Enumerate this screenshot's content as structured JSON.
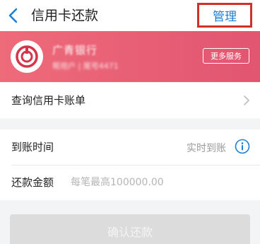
{
  "header": {
    "title": "信用卡还款",
    "manage_label": "管理"
  },
  "card": {
    "bank_name": "广青银行",
    "card_info": "帮用户 | 尾号4471",
    "more_services_label": "更多服务"
  },
  "query_bill": {
    "label": "查询信用卡账单"
  },
  "arrival": {
    "label": "到账时间",
    "value": "实时到账"
  },
  "amount": {
    "label": "还款金额",
    "placeholder": "每笔最高100000.00",
    "value": ""
  },
  "confirm_label": "确认还款",
  "colors": {
    "accent": "#1a7fd8",
    "card_gradient_start": "#ee6b7a",
    "card_gradient_end": "#e25571",
    "highlight_box": "#d0302a"
  }
}
